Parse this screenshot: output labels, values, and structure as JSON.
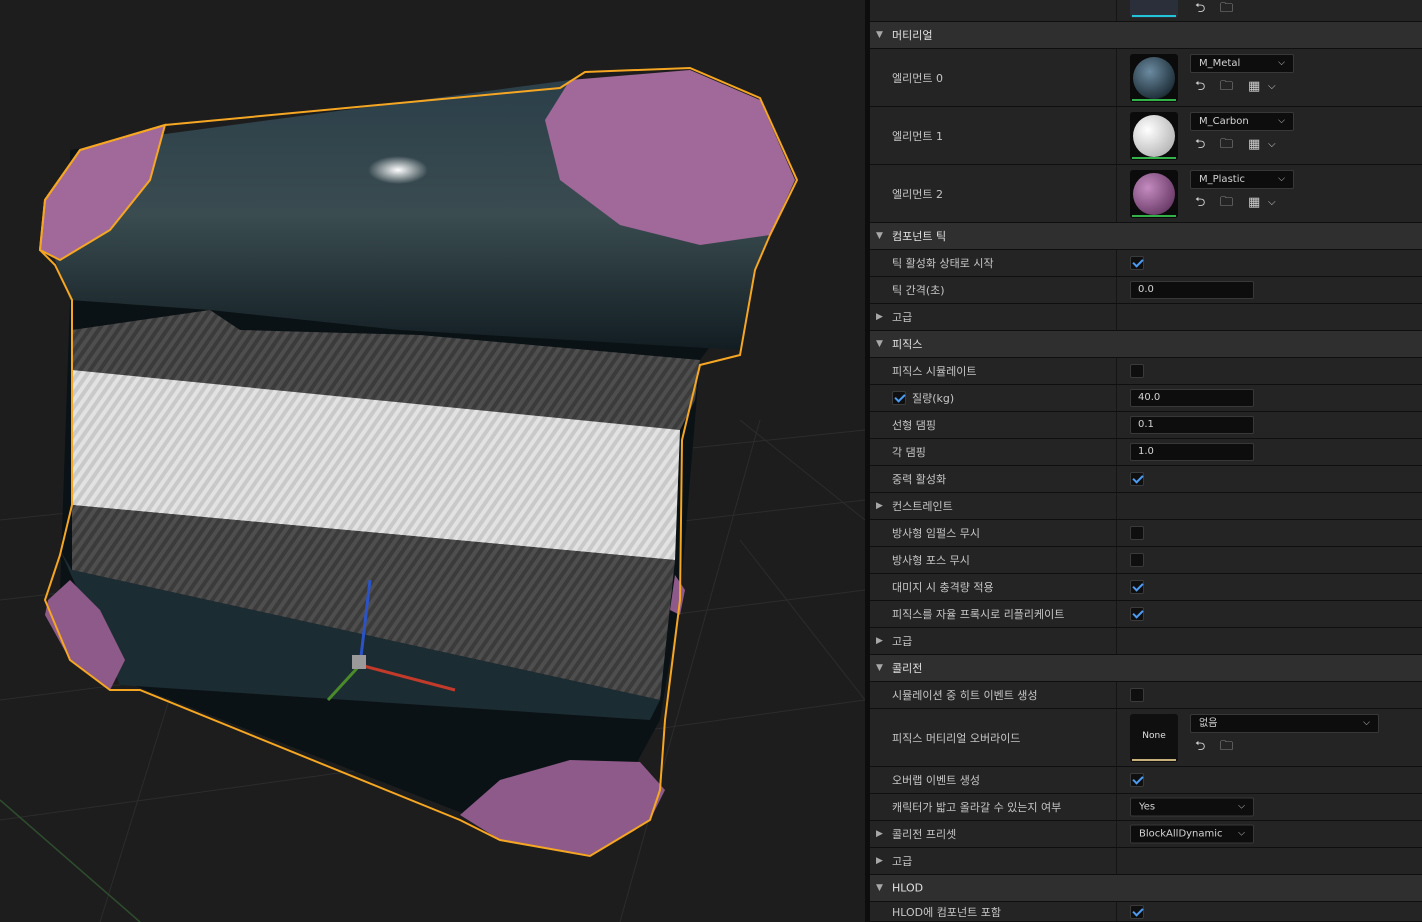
{
  "materials": {
    "title": "머티리얼",
    "elements": [
      {
        "label": "엘리먼트 0",
        "material": "M_Metal"
      },
      {
        "label": "엘리먼트 1",
        "material": "M_Carbon"
      },
      {
        "label": "엘리먼트 2",
        "material": "M_Plastic"
      }
    ]
  },
  "component_tick": {
    "title": "컴포넌트 틱",
    "start_with_tick_enabled": {
      "label": "틱 활성화 상태로 시작",
      "checked": true
    },
    "tick_interval": {
      "label": "틱 간격(초)",
      "value": "0.0"
    },
    "advanced": "고급"
  },
  "physics": {
    "title": "피직스",
    "simulate": {
      "label": "피직스 시뮬레이트",
      "checked": false
    },
    "mass": {
      "label": "질량(kg)",
      "value": "40.0",
      "override_checked": true
    },
    "linear_damping": {
      "label": "선형 댐핑",
      "value": "0.1"
    },
    "angular_damping": {
      "label": "각 댐핑",
      "value": "1.0"
    },
    "gravity": {
      "label": "중력 활성화",
      "checked": true
    },
    "constraints": "컨스트레인트",
    "ignore_radial_impulse": {
      "label": "방사형 임펄스 무시",
      "checked": false
    },
    "ignore_radial_force": {
      "label": "방사형 포스 무시",
      "checked": false
    },
    "apply_impulse_on_damage": {
      "label": "대미지 시 충격량 적용",
      "checked": true
    },
    "replicate_physics_to_autonomous_proxy": {
      "label": "피직스를 자율 프록시로 리플리케이트",
      "checked": true
    },
    "advanced": "고급"
  },
  "collision": {
    "title": "콜리전",
    "hit_events": {
      "label": "시뮬레이션 중 히트 이벤트 생성",
      "checked": false
    },
    "phys_material_override": {
      "label": "피직스 머티리얼 오버라이드",
      "thumb_text": "None",
      "value": "없음"
    },
    "overlap_events": {
      "label": "오버랩 이벤트 생성",
      "checked": true
    },
    "can_step_up": {
      "label": "캐릭터가 밟고 올라갈 수 있는지 여부",
      "value": "Yes"
    },
    "preset": {
      "label": "콜리전 프리셋",
      "value": "BlockAllDynamic"
    },
    "advanced": "고급"
  },
  "hlod": {
    "title": "HLOD",
    "include": {
      "label": "HLOD에 컴포넌트 포함",
      "checked": true
    }
  },
  "icons": [
    "browse-arrow-icon",
    "folder-search-icon",
    "checker-icon",
    "chevron-down-icon",
    "expand-arrow-icon",
    "collapse-arrow-icon"
  ],
  "colors": {
    "selection_outline": "#f5a623",
    "accent": "#4d9cf4",
    "plastic": "#a0699a",
    "thumb_bar": "#33b24a"
  }
}
